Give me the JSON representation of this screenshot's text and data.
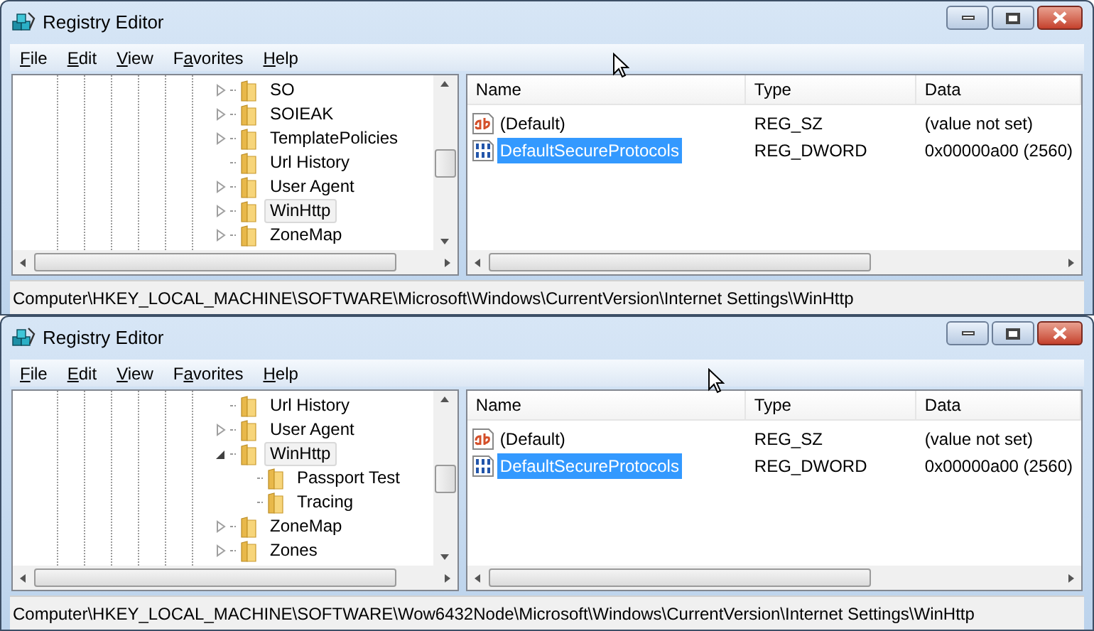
{
  "windows": [
    {
      "title": "Registry Editor",
      "menu": [
        {
          "key": "F",
          "post": "ile"
        },
        {
          "key": "E",
          "post": "dit"
        },
        {
          "key": "V",
          "post": "iew"
        },
        {
          "pre": "F",
          "key": "a",
          "post": "vorites"
        },
        {
          "key": "H",
          "post": "elp"
        }
      ],
      "tree": [
        {
          "name": "SO",
          "expandable": true,
          "expanded": false,
          "selected": false
        },
        {
          "name": "SOIEAK",
          "expandable": true,
          "expanded": false,
          "selected": false
        },
        {
          "name": "TemplatePolicies",
          "expandable": true,
          "expanded": false,
          "selected": false
        },
        {
          "name": "Url History",
          "expandable": false,
          "selected": false
        },
        {
          "name": "User Agent",
          "expandable": true,
          "expanded": false,
          "selected": false
        },
        {
          "name": "WinHttp",
          "expandable": true,
          "expanded": false,
          "selected": true
        },
        {
          "name": "ZoneMap",
          "expandable": true,
          "expanded": false,
          "selected": false
        }
      ],
      "values": {
        "columns": [
          "Name",
          "Type",
          "Data"
        ],
        "rows": [
          {
            "kind": "string",
            "name": "(Default)",
            "type": "REG_SZ",
            "data": "(value not set)",
            "selected": false
          },
          {
            "kind": "dword",
            "name": "DefaultSecureProtocols",
            "type": "REG_DWORD",
            "data": "0x00000a00 (2560)",
            "selected": true
          }
        ]
      },
      "status_bar": "Computer\\HKEY_LOCAL_MACHINE\\SOFTWARE\\Microsoft\\Windows\\CurrentVersion\\Internet Settings\\WinHttp"
    },
    {
      "title": "Registry Editor",
      "menu": [
        {
          "key": "F",
          "post": "ile"
        },
        {
          "key": "E",
          "post": "dit"
        },
        {
          "key": "V",
          "post": "iew"
        },
        {
          "pre": "F",
          "key": "a",
          "post": "vorites"
        },
        {
          "key": "H",
          "post": "elp"
        }
      ],
      "tree": [
        {
          "name": "Url History",
          "expandable": false,
          "selected": false
        },
        {
          "name": "User Agent",
          "expandable": true,
          "expanded": false,
          "selected": false
        },
        {
          "name": "WinHttp",
          "expandable": true,
          "expanded": true,
          "selected": true,
          "children": [
            {
              "name": "Passport Test",
              "expandable": false,
              "selected": false
            },
            {
              "name": "Tracing",
              "expandable": false,
              "selected": false
            }
          ]
        },
        {
          "name": "ZoneMap",
          "expandable": true,
          "expanded": false,
          "selected": false
        },
        {
          "name": "Zones",
          "expandable": true,
          "expanded": false,
          "selected": false
        }
      ],
      "values": {
        "columns": [
          "Name",
          "Type",
          "Data"
        ],
        "rows": [
          {
            "kind": "string",
            "name": "(Default)",
            "type": "REG_SZ",
            "data": "(value not set)",
            "selected": false
          },
          {
            "kind": "dword",
            "name": "DefaultSecureProtocols",
            "type": "REG_DWORD",
            "data": "0x00000a00 (2560)",
            "selected": true
          }
        ]
      },
      "status_bar": "Computer\\HKEY_LOCAL_MACHINE\\SOFTWARE\\Wow6432Node\\Microsoft\\Windows\\CurrentVersion\\Internet Settings\\WinHttp"
    }
  ]
}
